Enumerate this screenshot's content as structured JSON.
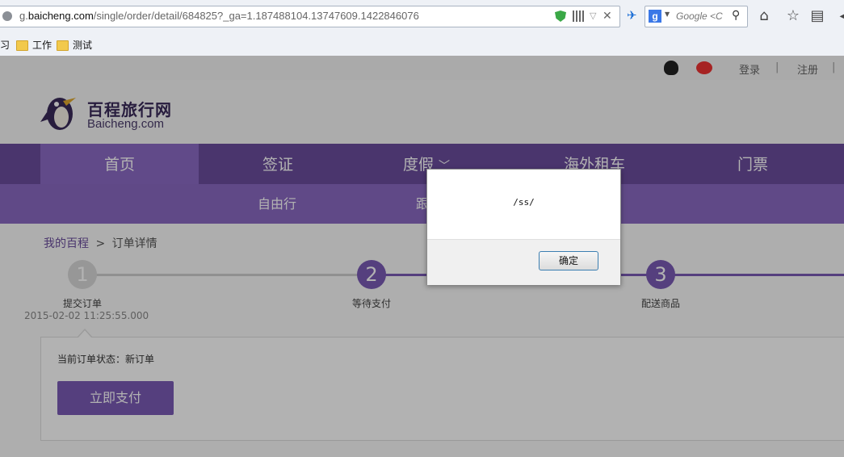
{
  "browser": {
    "url_prefix": "g.",
    "url_domain": "baicheng.com",
    "url_path": "/single/order/detail/684825?_ga=1.187488104.13747609.1422846076",
    "search_placeholder": "Google <C",
    "bookmarks": [
      {
        "label": "习"
      },
      {
        "label": "工作"
      },
      {
        "label": "测试"
      }
    ]
  },
  "site": {
    "top_links": {
      "login": "登录",
      "sep1": "|",
      "register": "注册",
      "sep2": "|"
    },
    "logo_cn": "百程旅行网",
    "logo_en": "Baicheng.com",
    "nav": [
      {
        "label": "首页"
      },
      {
        "label": "签证"
      },
      {
        "label": "度假"
      },
      {
        "label": "海外租车"
      },
      {
        "label": "门票"
      }
    ],
    "subnav": [
      {
        "label": "自由行"
      },
      {
        "label": "跟"
      }
    ],
    "breadcrumb": {
      "home": "我的百程",
      "sep": ">",
      "current": "订单详情"
    },
    "steps": [
      {
        "num": "1",
        "label": "提交订单",
        "time": "2015-02-02 11:25:55.000"
      },
      {
        "num": "2",
        "label": "等待支付"
      },
      {
        "num": "3",
        "label": "配送商品"
      }
    ],
    "order_status": "当前订单状态：新订单",
    "pay_button": "立即支付"
  },
  "dialog": {
    "message": "/ss/",
    "ok_label": "确定"
  },
  "colors": {
    "brand_purple": "#6a4c9c",
    "active_purple": "#8c6bc4",
    "step_purple": "#7a5bb5"
  }
}
